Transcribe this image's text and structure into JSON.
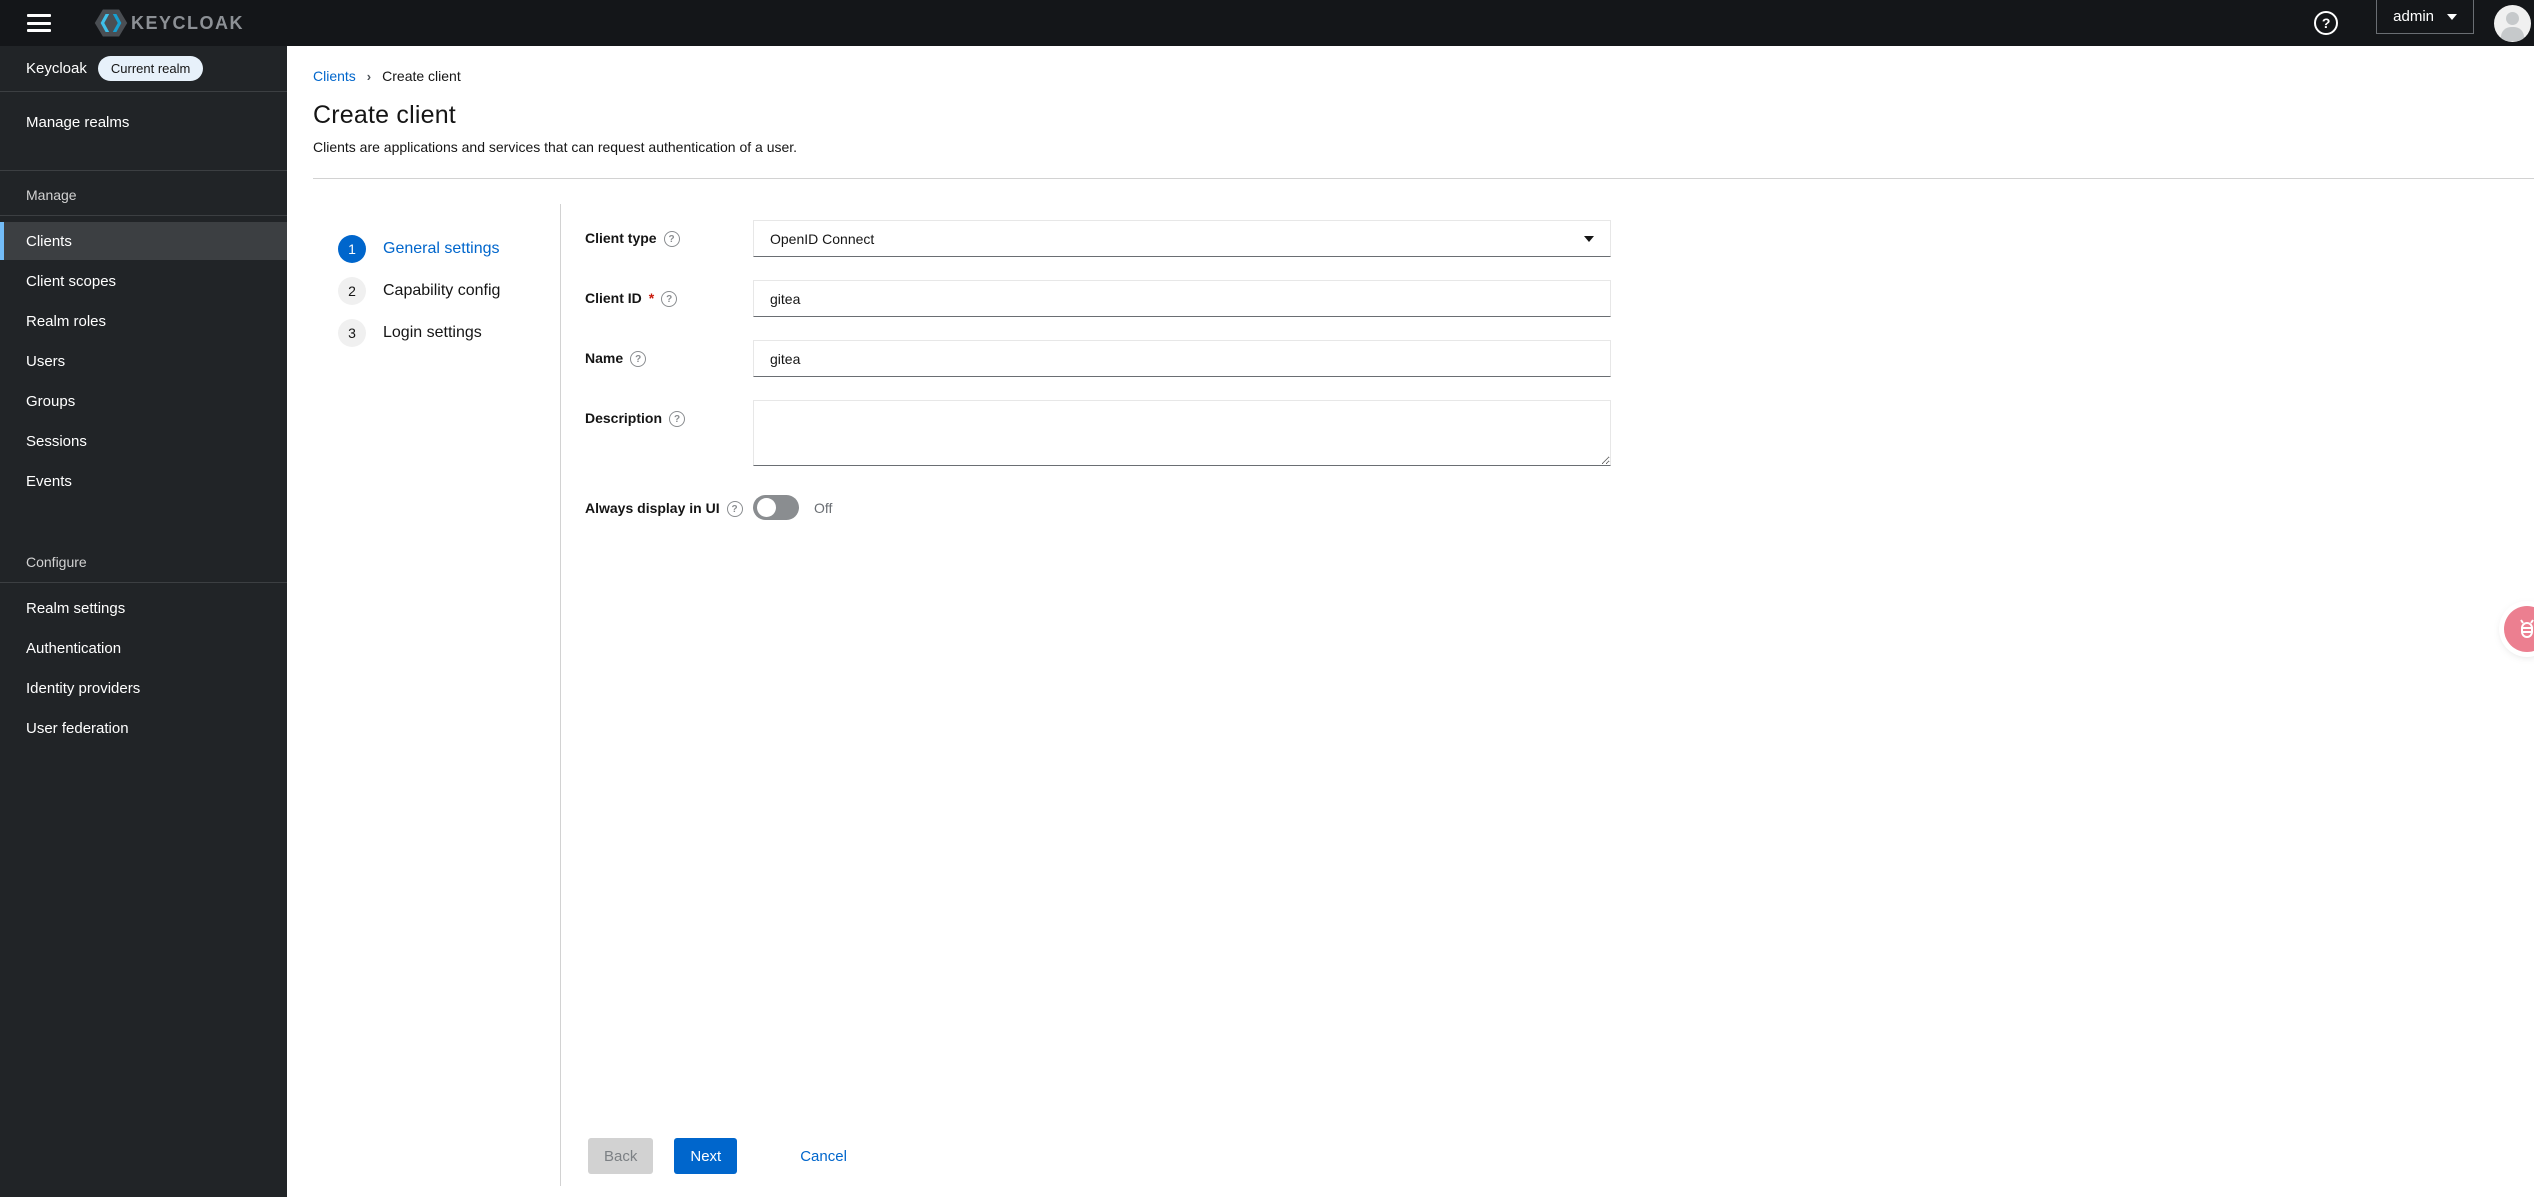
{
  "topbar": {
    "brand": "KEYCLOAK",
    "user": "admin"
  },
  "sidebar": {
    "realm": {
      "name": "Keycloak",
      "badge": "Current realm"
    },
    "manage_realms": "Manage realms",
    "sections": [
      {
        "label": "Manage",
        "items": [
          {
            "label": "Clients",
            "active": true
          },
          {
            "label": "Client scopes"
          },
          {
            "label": "Realm roles"
          },
          {
            "label": "Users"
          },
          {
            "label": "Groups"
          },
          {
            "label": "Sessions"
          },
          {
            "label": "Events"
          }
        ]
      },
      {
        "label": "Configure",
        "items": [
          {
            "label": "Realm settings"
          },
          {
            "label": "Authentication"
          },
          {
            "label": "Identity providers"
          },
          {
            "label": "User federation"
          }
        ]
      }
    ]
  },
  "breadcrumb": {
    "link": "Clients",
    "current": "Create client"
  },
  "page": {
    "title": "Create client",
    "subtitle": "Clients are applications and services that can request authentication of a user."
  },
  "wizard": {
    "steps": [
      {
        "number": "1",
        "label": "General settings",
        "active": true
      },
      {
        "number": "2",
        "label": "Capability config"
      },
      {
        "number": "3",
        "label": "Login settings"
      }
    ]
  },
  "form": {
    "client_type": {
      "label": "Client type",
      "value": "OpenID Connect"
    },
    "client_id": {
      "label": "Client ID",
      "required": "*",
      "value": "gitea"
    },
    "name": {
      "label": "Name",
      "value": "gitea"
    },
    "description": {
      "label": "Description",
      "value": ""
    },
    "always_display": {
      "label": "Always display in UI",
      "state": "Off",
      "enabled": false
    }
  },
  "footer": {
    "back": "Back",
    "next": "Next",
    "cancel": "Cancel"
  },
  "icons": {
    "question": "?",
    "breadcrumb_separator": "›"
  },
  "colors": {
    "accent": "#0066cc",
    "danger": "#c9190b",
    "topbar_bg": "#141619",
    "sidebar_bg": "#212427",
    "sidebar_active_bg": "#3c3f42",
    "sidebar_active_indicator": "#73bcf7",
    "toggle_off": "#8a8d90",
    "disabled_button": "#d2d2d2",
    "fab": "#ec7f90"
  }
}
